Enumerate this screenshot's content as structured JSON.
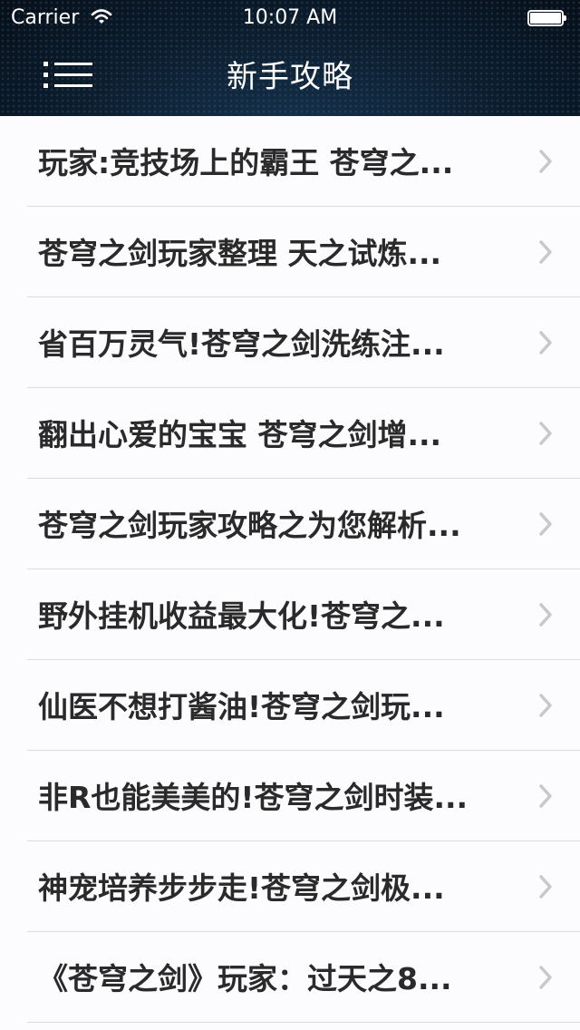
{
  "status_bar": {
    "carrier": "Carrier",
    "time": "10:07 AM"
  },
  "nav": {
    "title": "新手攻略"
  },
  "articles": [
    {
      "title": "玩家:竞技场上的霸王 苍穹之..."
    },
    {
      "title": "苍穹之剑玩家整理 天之试炼..."
    },
    {
      "title": "省百万灵气!苍穹之剑洗练注..."
    },
    {
      "title": "翻出心爱的宝宝 苍穹之剑增..."
    },
    {
      "title": "苍穹之剑玩家攻略之为您解析..."
    },
    {
      "title": "野外挂机收益最大化!苍穹之..."
    },
    {
      "title": "仙医不想打酱油!苍穹之剑玩..."
    },
    {
      "title": "非R也能美美的!苍穹之剑时装..."
    },
    {
      "title": "神宠培养步步走!苍穹之剑极..."
    },
    {
      "title": "《苍穹之剑》玩家：过天之8..."
    }
  ],
  "icons": {
    "menu": "list-menu-icon",
    "row_accessory": "chevron-right-icon",
    "wifi": "wifi-icon",
    "battery": "battery-icon"
  },
  "colors": {
    "header_bg": "#0c1d2d",
    "separator": "#dcdce0",
    "row_text": "#2a2a2a",
    "chevron": "#c7c7cc"
  }
}
